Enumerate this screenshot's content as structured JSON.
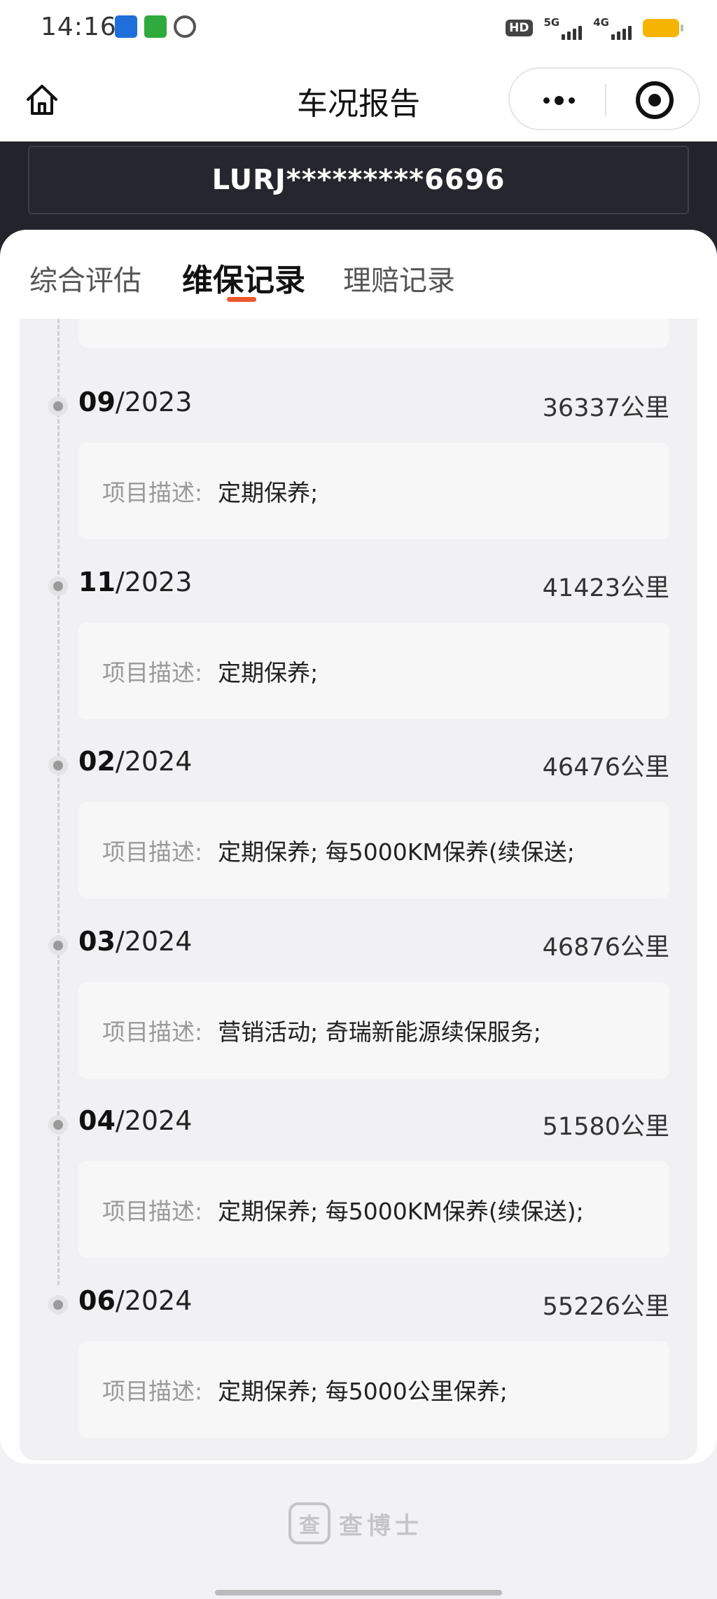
{
  "status_bar": {
    "time": "14:16",
    "hd": "HD",
    "net1": "5G",
    "net2": "4G",
    "battery_color": "#f5b400"
  },
  "header": {
    "title": "车况报告",
    "home_icon": "home-icon",
    "more_icon": "more-dots-icon",
    "close_icon": "target-close-icon"
  },
  "vin": "LURJ*********6696",
  "tabs": [
    {
      "label": "综合评估",
      "active": false
    },
    {
      "label": "维保记录",
      "active": true
    },
    {
      "label": "理赔记录",
      "active": false
    }
  ],
  "accent_color": "#f0572a",
  "records": [
    {
      "month": "09",
      "year": "/2023",
      "km": "36337公里",
      "desc_label": "项目描述:",
      "desc": "定期保养;"
    },
    {
      "month": "11",
      "year": "/2023",
      "km": "41423公里",
      "desc_label": "项目描述:",
      "desc": "定期保养;"
    },
    {
      "month": "02",
      "year": "/2024",
      "km": "46476公里",
      "desc_label": "项目描述:",
      "desc": "定期保养; 每5000KM保养(续保送;"
    },
    {
      "month": "03",
      "year": "/2024",
      "km": "46876公里",
      "desc_label": "项目描述:",
      "desc": "营销活动; 奇瑞新能源续保服务;"
    },
    {
      "month": "04",
      "year": "/2024",
      "km": "51580公里",
      "desc_label": "项目描述:",
      "desc": "定期保养; 每5000KM保养(续保送);"
    },
    {
      "month": "06",
      "year": "/2024",
      "km": "55226公里",
      "desc_label": "项目描述:",
      "desc": "定期保养; 每5000公里保养;"
    }
  ],
  "footer": {
    "logo_icon": "查",
    "brand": "查博士"
  }
}
